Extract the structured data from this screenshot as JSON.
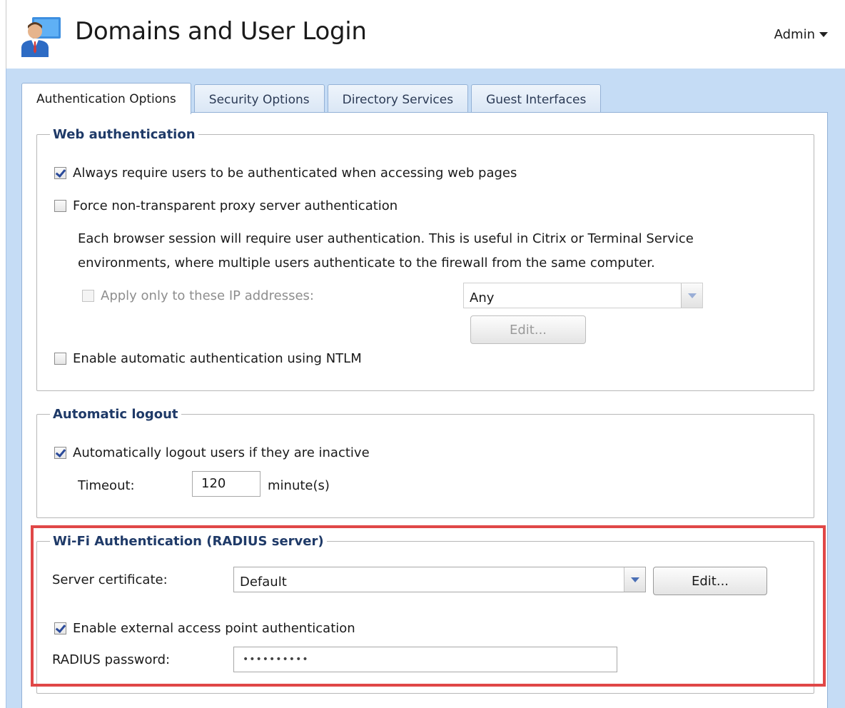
{
  "header": {
    "title": "Domains and User Login",
    "user_menu": "Admin",
    "icon": "user-login-icon"
  },
  "tabs": [
    {
      "label": "Authentication Options",
      "active": true
    },
    {
      "label": "Security Options",
      "active": false
    },
    {
      "label": "Directory Services",
      "active": false
    },
    {
      "label": "Guest Interfaces",
      "active": false
    }
  ],
  "web_auth": {
    "legend": "Web authentication",
    "always_require": {
      "label": "Always require users to be authenticated when accessing web pages",
      "checked": true
    },
    "force_proxy": {
      "label": "Force non-transparent proxy server authentication",
      "checked": false
    },
    "note_line1": "Each browser session will require user authentication. This is useful in Citrix or Terminal Service",
    "note_line2": "environments, where multiple users authenticate to the firewall from the same computer.",
    "apply_ip": {
      "label": "Apply only to these IP addresses:",
      "checked": false,
      "disabled": true
    },
    "ip_select": {
      "value": "Any"
    },
    "edit_button": "Edit...",
    "ntlm": {
      "label": "Enable automatic authentication using NTLM",
      "checked": false
    }
  },
  "auto_logout": {
    "legend": "Automatic logout",
    "inactive": {
      "label": "Automatically logout users if they are inactive",
      "checked": true
    },
    "timeout_label": "Timeout:",
    "timeout_value": "120",
    "timeout_unit": "minute(s)"
  },
  "wifi_auth": {
    "legend": "Wi-Fi Authentication (RADIUS server)",
    "cert_label": "Server certificate:",
    "cert_value": "Default",
    "edit_button": "Edit...",
    "external_ap": {
      "label": "Enable external access point authentication",
      "checked": true
    },
    "radius_label": "RADIUS password:",
    "radius_value": "••••••••••"
  },
  "colors": {
    "frame_blue": "#c5dcf5",
    "legend_blue": "#1f3a68",
    "highlight_red": "#e04747"
  }
}
